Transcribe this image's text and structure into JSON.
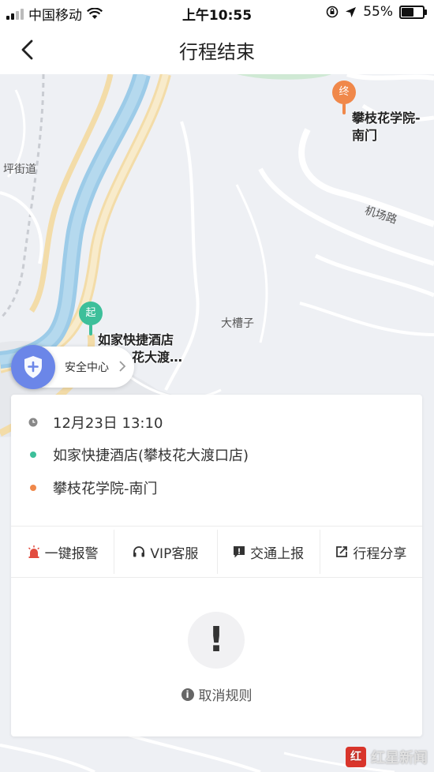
{
  "status_bar": {
    "carrier": "中国移动",
    "time": "上午10:55",
    "battery": "55%",
    "battery_level": 0.55
  },
  "nav": {
    "title": "行程结束"
  },
  "map": {
    "labels": {
      "road_left": "坪街道",
      "airport_road": "机场路",
      "area": "大槽子"
    },
    "start": {
      "pin": "起",
      "name_line1": "如家快捷酒店",
      "name_line2": "花大渡…"
    },
    "end": {
      "pin": "终",
      "name_line1": "攀枝花学院-",
      "name_line2": "南门"
    }
  },
  "safety": {
    "label": "安全中心"
  },
  "trip": {
    "time": "12月23日 13:10",
    "origin": "如家快捷酒店(攀枝花大渡口店)",
    "destination": "攀枝花学院-南门"
  },
  "actions": [
    {
      "label": "一键报警",
      "icon": "alarm-icon"
    },
    {
      "label": "VIP客服",
      "icon": "headset-icon"
    },
    {
      "label": "交通上报",
      "icon": "report-icon"
    },
    {
      "label": "行程分享",
      "icon": "share-icon"
    }
  ],
  "notice": {
    "symbol": "!",
    "cancel_rule": "取消规则"
  },
  "watermark": {
    "logo": "红",
    "text": "红星新闻"
  },
  "colors": {
    "start_green": "#3dbf9a",
    "end_orange": "#f0884a",
    "safety_blue": "#6b86e8",
    "alarm_red": "#e24c3f"
  }
}
